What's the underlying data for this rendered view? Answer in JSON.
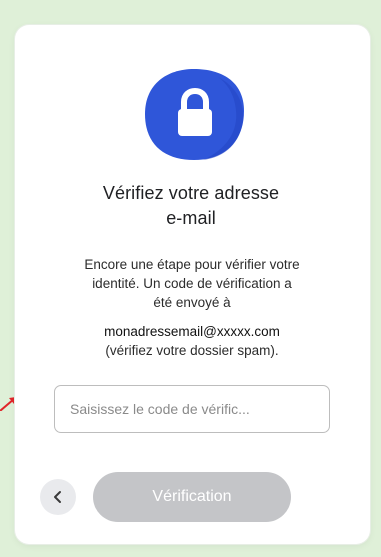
{
  "dialog": {
    "title_line1": "Vérifiez votre adresse",
    "title_line2": "e-mail",
    "description_lines": [
      "Encore une étape pour vérifier votre",
      "identité. Un code de vérification a",
      "été envoyé à"
    ],
    "email": "monadressemail@xxxxx.com",
    "spam_note": "(vérifiez votre dossier spam).",
    "code_input": {
      "placeholder": "Saisissez le code de vérific...",
      "value": ""
    },
    "verify_button_label": "Vérification",
    "back_icon": "chevron-left-icon",
    "lock_icon": "lock-icon"
  },
  "colors": {
    "page_background": "#dff0d8",
    "card_background": "#ffffff",
    "lock_badge": "#2f56d9",
    "button_disabled": "#c4c5c8",
    "annotation_arrow": "#e0262a"
  }
}
